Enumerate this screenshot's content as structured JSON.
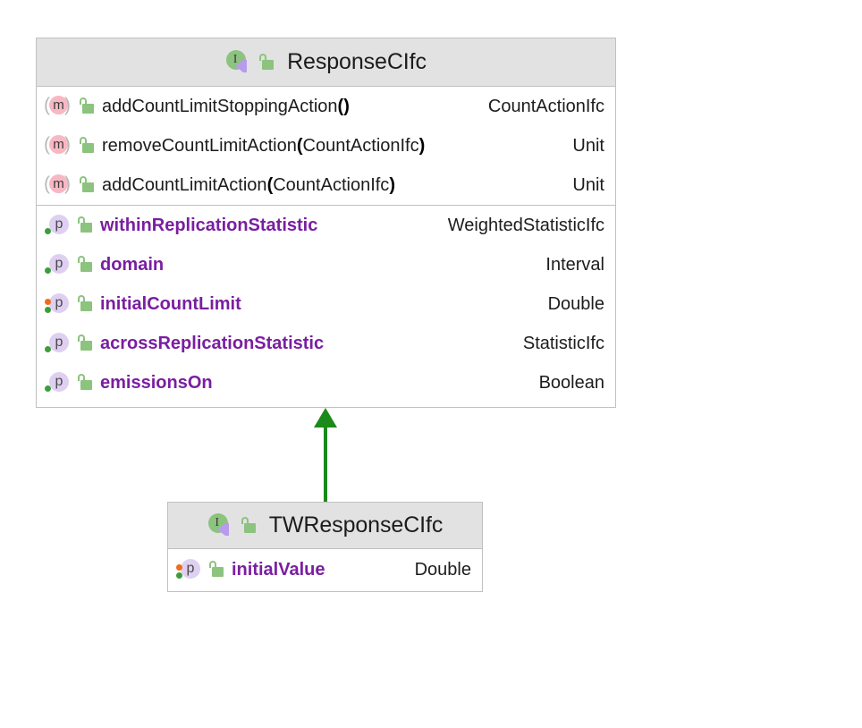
{
  "diagram": {
    "type": "uml-class-diagram",
    "relationship": "implements",
    "relationship_arrow": "green-solid-triangle-up"
  },
  "classes": [
    {
      "id": "response-cifc",
      "name": "ResponseCIfc",
      "stereotype": "interface",
      "visibility": "public",
      "sections": [
        {
          "kind": "methods",
          "members": [
            {
              "icon": "method-icon",
              "visibility_icon": "open-padlock-icon",
              "name": "addCountLimitStoppingAction",
              "paren_open": "(",
              "arg": "",
              "paren_close": ")",
              "type": "CountActionIfc"
            },
            {
              "icon": "method-icon",
              "visibility_icon": "open-padlock-icon",
              "name": "removeCountLimitAction",
              "paren_open": "(",
              "arg": "CountActionIfc",
              "paren_close": ")",
              "type": "Unit"
            },
            {
              "icon": "method-icon",
              "visibility_icon": "open-padlock-icon",
              "name": "addCountLimitAction",
              "paren_open": "(",
              "arg": "CountActionIfc",
              "paren_close": ")",
              "type": "Unit"
            }
          ]
        },
        {
          "kind": "properties",
          "members": [
            {
              "icon": "property-icon",
              "visibility_icon": "open-padlock-icon",
              "access": "read-only",
              "name": "withinReplicationStatistic",
              "type": "WeightedStatisticIfc"
            },
            {
              "icon": "property-icon",
              "visibility_icon": "open-padlock-icon",
              "access": "read-only",
              "name": "domain",
              "type": "Interval"
            },
            {
              "icon": "property-icon",
              "visibility_icon": "open-padlock-icon",
              "access": "read-write",
              "name": "initialCountLimit",
              "type": "Double"
            },
            {
              "icon": "property-icon",
              "visibility_icon": "open-padlock-icon",
              "access": "read-only",
              "name": "acrossReplicationStatistic",
              "type": "StatisticIfc"
            },
            {
              "icon": "property-icon",
              "visibility_icon": "open-padlock-icon",
              "access": "read-only",
              "name": "emissionsOn",
              "type": "Boolean"
            }
          ]
        }
      ]
    },
    {
      "id": "tw-response-cifc",
      "name": "TWResponseCIfc",
      "stereotype": "interface",
      "visibility": "public",
      "sections": [
        {
          "kind": "properties",
          "members": [
            {
              "icon": "property-icon",
              "visibility_icon": "open-padlock-icon",
              "access": "read-write",
              "name": "initialValue",
              "type": "Double"
            }
          ]
        }
      ]
    }
  ],
  "colors": {
    "header_bg": "#e2e2e2",
    "box_border": "#c0c0c0",
    "box_bg": "#ffffff",
    "property_name": "#7a1ea1",
    "member_text": "#1c1c1c",
    "arrow": "#1a8a1a",
    "interface_icon": "#8cc37e",
    "implements_marker": "#b79cec",
    "method_icon": "#f7b8c4",
    "property_icon": "#dfd0f2",
    "lock_icon": "#8cc37e",
    "read_dot": "#3d9d3d",
    "write_dot": "#ef6c1a"
  },
  "glyphs": {
    "interface_letter": "I",
    "method_letter": "m",
    "property_letter": "p",
    "paren_left": "(",
    "paren_right": ")"
  }
}
